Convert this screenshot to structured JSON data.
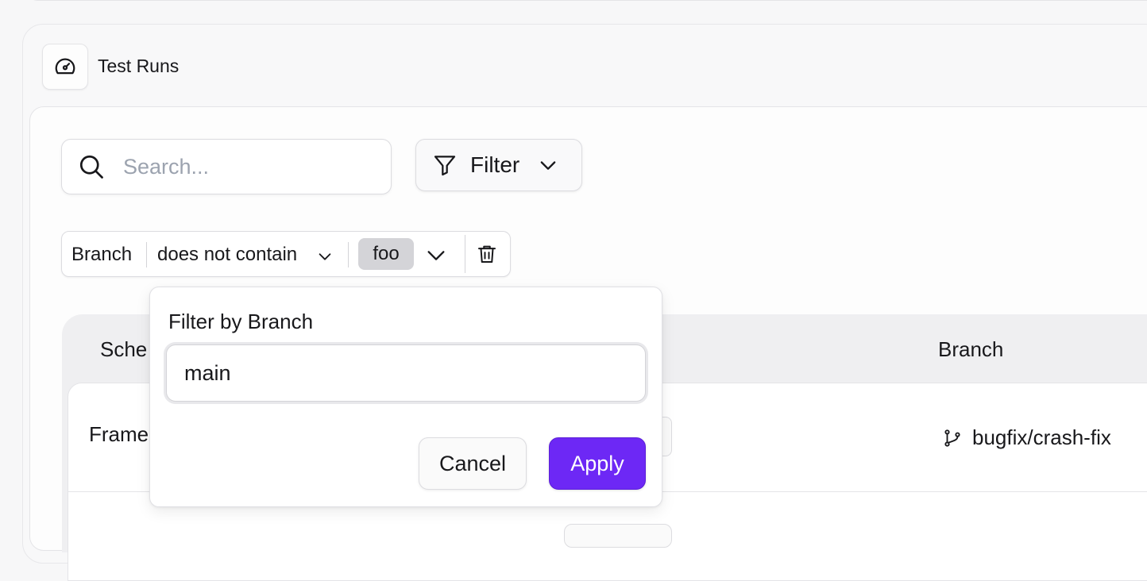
{
  "header": {
    "title": "Test Runs",
    "icon": "gauge-icon"
  },
  "toolbar": {
    "search_placeholder": "Search...",
    "filter_label": "Filter"
  },
  "active_filter": {
    "field": "Branch",
    "operator": "does not contain",
    "value": "foo"
  },
  "table": {
    "columns": [
      "Sche",
      "Branch"
    ],
    "rows": [
      {
        "name": "Frame",
        "branch": "bugfix/crash-fix"
      }
    ]
  },
  "popover": {
    "title": "Filter by Branch",
    "input_value": "main",
    "cancel_label": "Cancel",
    "apply_label": "Apply"
  },
  "colors": {
    "accent": "#6d28f5",
    "background": "#f7f7f8",
    "border": "#e4e4e7"
  }
}
